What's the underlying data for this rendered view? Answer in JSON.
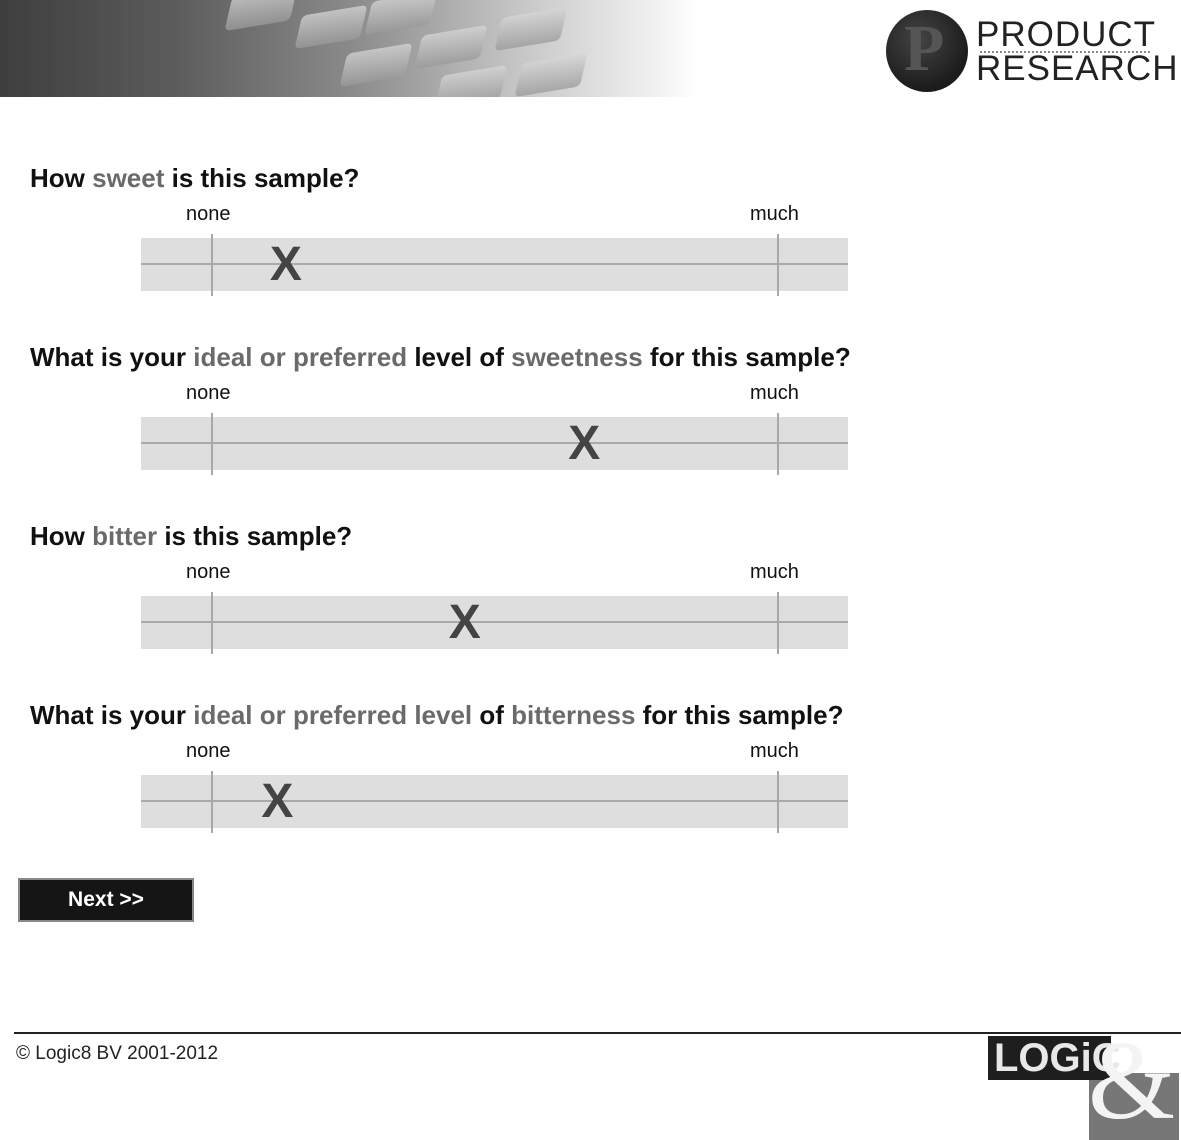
{
  "header": {
    "logo_line1": "PRODUCT",
    "logo_line2": "RESEARCH",
    "logo_letter": "P"
  },
  "questions": [
    {
      "parts": [
        "How ",
        "sweet",
        " is this sample?"
      ],
      "label_min": "none",
      "label_max": "much",
      "mark": "X",
      "value": 0.205
    },
    {
      "parts": [
        "What is your ",
        "ideal or preferred",
        " level of ",
        "sweetness",
        " for this sample?"
      ],
      "label_min": "none",
      "label_max": "much",
      "mark": "X",
      "value": 0.627
    },
    {
      "parts": [
        "How ",
        "bitter",
        " is this sample?"
      ],
      "label_min": "none",
      "label_max": "much",
      "mark": "X",
      "value": 0.458
    },
    {
      "parts": [
        "What is your ",
        "ideal or preferred level",
        " of ",
        "bitterness",
        " for this sample?"
      ],
      "label_min": "none",
      "label_max": "much",
      "mark": "X",
      "value": 0.193
    }
  ],
  "next_button_label": "Next >>",
  "footer": {
    "copyright": "© Logic8 BV 2001-2012",
    "logo_text": "LOGiC",
    "logo_amp": "&"
  },
  "colors": {
    "highlight_text": "#6a6a6a",
    "track": "#dedede",
    "button": "#151515"
  }
}
